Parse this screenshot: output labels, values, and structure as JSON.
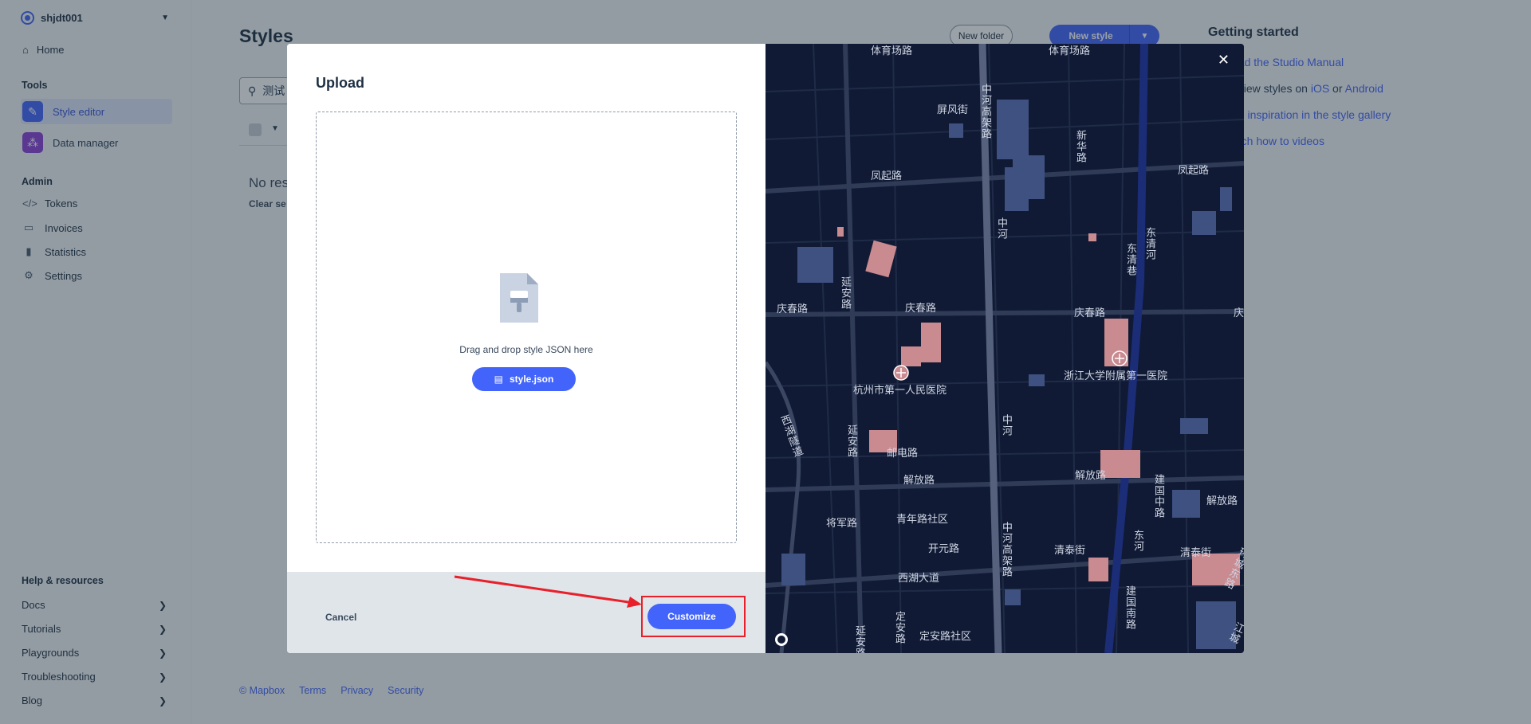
{
  "sidebar": {
    "account": "shjdt001",
    "home": "Home",
    "tools_title": "Tools",
    "tools": [
      "Style editor",
      "Data manager"
    ],
    "admin_title": "Admin",
    "admin": [
      "Tokens",
      "Invoices",
      "Statistics",
      "Settings"
    ],
    "help_title": "Help & resources",
    "help": [
      "Docs",
      "Tutorials",
      "Playgrounds",
      "Troubleshooting",
      "Blog"
    ]
  },
  "main": {
    "title": "Styles",
    "new_folder": "New folder",
    "new_style": "New style",
    "search_value": "测试",
    "no_results": "No res",
    "clear_search": "Clear se"
  },
  "getting_started": {
    "title": "Getting started",
    "links": [
      {
        "pre": "",
        "a": "ead the Studio Manual",
        "mid": "",
        "b": ""
      },
      {
        "pre": "eview styles on ",
        "a": "iOS",
        "mid": " or ",
        "b": "Android"
      },
      {
        "pre": "",
        "a": "nd inspiration in the style gallery",
        "mid": "",
        "b": ""
      },
      {
        "pre": "",
        "a": "atch how to videos",
        "mid": "",
        "b": ""
      }
    ]
  },
  "footer": [
    "© Mapbox",
    "Terms",
    "Privacy",
    "Security"
  ],
  "modal": {
    "title": "Upload",
    "drop_text": "Drag and drop style JSON here",
    "file_name": "style.json",
    "cancel": "Cancel",
    "customize": "Customize"
  },
  "map": {
    "labels": {
      "tiyuchanglu": "体育场路",
      "tiyuchanglu2": "体育场路",
      "pingfengjie": "屏风街",
      "zhonghegaojialu": "中河高架路",
      "xinhualu": "新华路",
      "fengqilu": "凤起路",
      "fengqilu2": "凤起路",
      "zhonghe": "中河",
      "dongqinghe": "东清河",
      "dongqingxiang": "东清巷",
      "yananlu": "延安路",
      "qingchunlu1": "庆春路",
      "qingchunlu2": "庆春路",
      "qingchunlu3": "庆春路",
      "qing": "庆",
      "hospital1": "杭州市第一人民医院",
      "hospital2": "浙江大学附属第一医院",
      "zhonghe2": "中河",
      "xihuandanlu": "西湖隧道",
      "yanan2": "延安路",
      "youdianlu": "邮电路",
      "jiefanglu1": "解放路",
      "jiefanglu2": "解放路",
      "jiefanglu3": "解放路",
      "jianguozhonglu": "建国中路",
      "jiangjunlu": "将军路",
      "qingnianlu": "青年路社区",
      "kaiyuanlu": "开元路",
      "zhonghegaojia2": "中河高架路",
      "qingtaijie": "清泰街",
      "qingtaijie2": "清泰街",
      "dong": "东河",
      "xihudadao": "西湖大道",
      "jianguonanlu": "建国南路",
      "dinganlu": "定安路",
      "yanan3": "延安路",
      "dinganlushequ": "定安路社区",
      "fanglu": "环城东路",
      "jiang": "江城"
    }
  }
}
